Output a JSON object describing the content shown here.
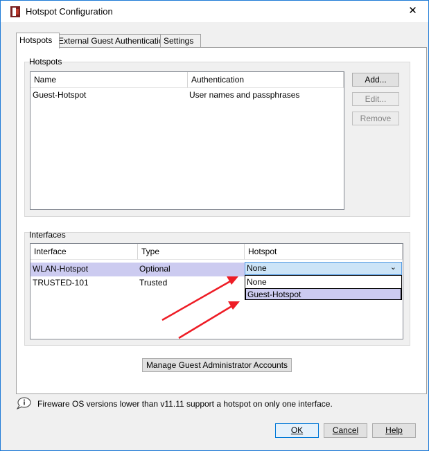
{
  "window": {
    "title": "Hotspot Configuration",
    "close_glyph": "✕"
  },
  "tabs": [
    {
      "label": "Hotspots",
      "active": true
    },
    {
      "label": "External Guest Authentication",
      "active": false
    },
    {
      "label": "Settings",
      "active": false
    }
  ],
  "hotspots_group": {
    "label": "Hotspots",
    "columns": [
      "Name",
      "Authentication"
    ],
    "rows": [
      {
        "name": "Guest-Hotspot",
        "auth": "User names and passphrases"
      }
    ],
    "buttons": {
      "add": "Add...",
      "edit": "Edit...",
      "remove": "Remove"
    }
  },
  "interfaces_group": {
    "label": "Interfaces",
    "columns": [
      "Interface",
      "Type",
      "Hotspot"
    ],
    "rows": [
      {
        "interface": "WLAN-Hotspot",
        "type": "Optional",
        "hotspot": "None",
        "selected": true
      },
      {
        "interface": "TRUSTED-101",
        "type": "Trusted",
        "hotspot": ""
      }
    ],
    "dropdown_options": [
      "None",
      "Guest-Hotspot"
    ],
    "dropdown_highlight": "Guest-Hotspot"
  },
  "manage_button": "Manage Guest Administrator Accounts",
  "info_text": "Fireware OS versions lower than v11.11 support a hotspot on only one interface.",
  "footer": {
    "ok": "OK",
    "cancel": "Cancel",
    "help": "Help"
  },
  "colors": {
    "accent": "#0078d7",
    "selection": "#cccbf0",
    "annotation_arrow": "#ee1c25"
  },
  "icons": [
    "app-icon",
    "close-icon",
    "info-icon",
    "chevron-down-icon",
    "annotation-arrow"
  ]
}
